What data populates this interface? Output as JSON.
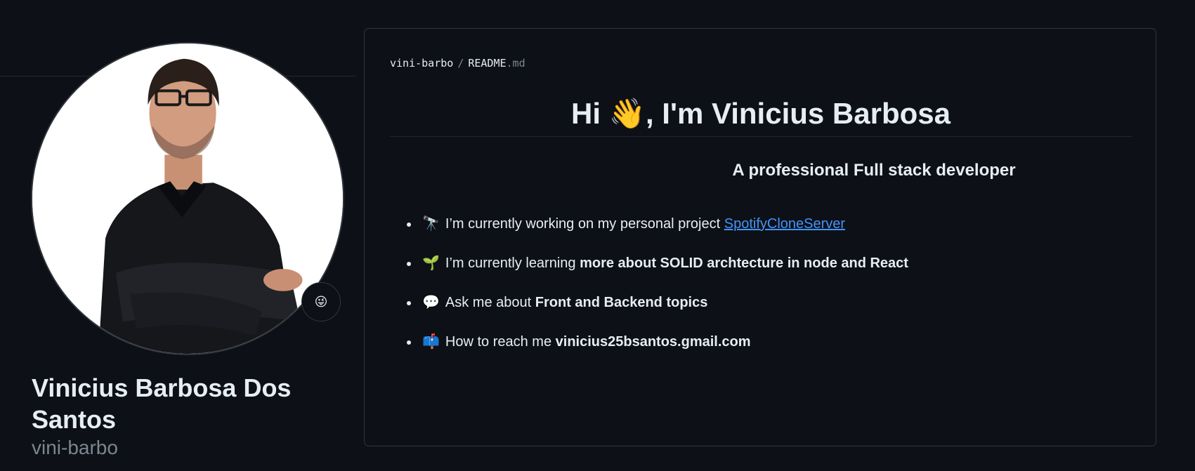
{
  "profile": {
    "full_name": "Vinicius Barbosa Dos Santos",
    "login": "vini-barbo",
    "status_emoji": "😜",
    "avatar_icon": "person-photo"
  },
  "readme": {
    "path_user": "vini-barbo",
    "path_separator": "/",
    "path_file": "README",
    "path_ext": ".md",
    "title": "Hi 👋, I'm Vinicius Barbosa",
    "subtitle": "A professional Full stack developer",
    "bullets": [
      {
        "emoji": "🔭",
        "text": "I’m currently working on my personal project ",
        "link": "SpotifyCloneServer"
      },
      {
        "emoji": "🌱",
        "text": "I’m currently learning ",
        "bold": "more about SOLID archtecture in node and React"
      },
      {
        "emoji": "💬",
        "text": "Ask me about ",
        "bold": "Front and Backend topics"
      },
      {
        "emoji": "📫",
        "text": "How to reach me ",
        "bold": "vinicius25bsantos.gmail.com"
      }
    ]
  },
  "colors": {
    "background": "#0d1117",
    "border": "#30363d",
    "text": "#e6edf3",
    "muted": "#7d8590",
    "link": "#4493f8"
  }
}
